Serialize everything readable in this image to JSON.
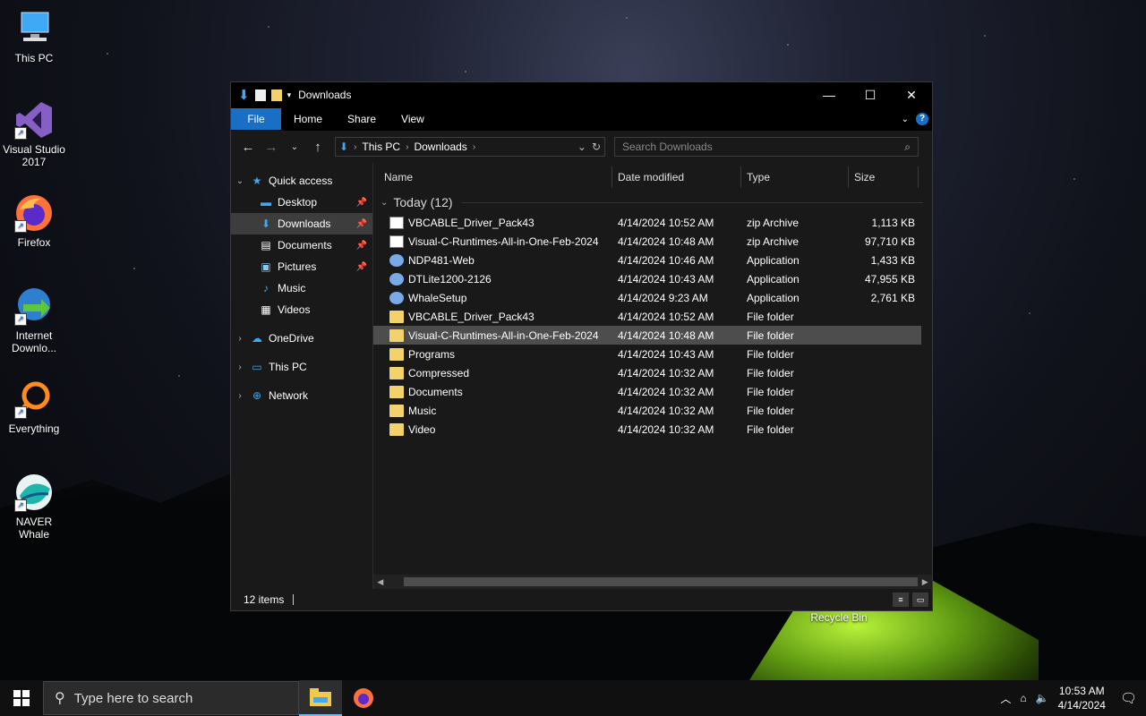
{
  "desktop": {
    "icons": [
      {
        "label": "This PC"
      },
      {
        "label": "Visual Studio 2017"
      },
      {
        "label": "Firefox"
      },
      {
        "label": "Internet Downlo..."
      },
      {
        "label": "Everything"
      },
      {
        "label": "NAVER Whale"
      }
    ],
    "recycle_bin": "Recycle Bin"
  },
  "window": {
    "title": "Downloads",
    "ribbon_tabs": [
      "File",
      "Home",
      "Share",
      "View"
    ],
    "help_glyph": "?",
    "address": {
      "segments": [
        "This PC",
        "Downloads"
      ]
    },
    "search_placeholder": "Search Downloads",
    "sidebar": {
      "quick_access": "Quick access",
      "pinned": [
        {
          "label": "Desktop",
          "pinned": true
        },
        {
          "label": "Downloads",
          "pinned": true,
          "selected": true
        },
        {
          "label": "Documents",
          "pinned": true
        },
        {
          "label": "Pictures",
          "pinned": true
        },
        {
          "label": "Music",
          "pinned": false
        },
        {
          "label": "Videos",
          "pinned": false
        }
      ],
      "onedrive": "OneDrive",
      "this_pc": "This PC",
      "network": "Network"
    },
    "columns": {
      "name": "Name",
      "date": "Date modified",
      "type": "Type",
      "size": "Size"
    },
    "group": "Today (12)",
    "files": [
      {
        "name": "VBCABLE_Driver_Pack43",
        "date": "4/14/2024 10:52 AM",
        "type": "zip Archive",
        "size": "1,113 KB",
        "icon": "zip"
      },
      {
        "name": "Visual-C-Runtimes-All-in-One-Feb-2024",
        "date": "4/14/2024 10:48 AM",
        "type": "zip Archive",
        "size": "97,710 KB",
        "icon": "zip"
      },
      {
        "name": "NDP481-Web",
        "date": "4/14/2024 10:46 AM",
        "type": "Application",
        "size": "1,433 KB",
        "icon": "app"
      },
      {
        "name": "DTLite1200-2126",
        "date": "4/14/2024 10:43 AM",
        "type": "Application",
        "size": "47,955 KB",
        "icon": "app"
      },
      {
        "name": "WhaleSetup",
        "date": "4/14/2024 9:23 AM",
        "type": "Application",
        "size": "2,761 KB",
        "icon": "app"
      },
      {
        "name": "VBCABLE_Driver_Pack43",
        "date": "4/14/2024 10:52 AM",
        "type": "File folder",
        "size": "",
        "icon": "folder"
      },
      {
        "name": "Visual-C-Runtimes-All-in-One-Feb-2024",
        "date": "4/14/2024 10:48 AM",
        "type": "File folder",
        "size": "",
        "icon": "folder",
        "selected": true
      },
      {
        "name": "Programs",
        "date": "4/14/2024 10:43 AM",
        "type": "File folder",
        "size": "",
        "icon": "folder"
      },
      {
        "name": "Compressed",
        "date": "4/14/2024 10:32 AM",
        "type": "File folder",
        "size": "",
        "icon": "folder"
      },
      {
        "name": "Documents",
        "date": "4/14/2024 10:32 AM",
        "type": "File folder",
        "size": "",
        "icon": "folder"
      },
      {
        "name": "Music",
        "date": "4/14/2024 10:32 AM",
        "type": "File folder",
        "size": "",
        "icon": "folder"
      },
      {
        "name": "Video",
        "date": "4/14/2024 10:32 AM",
        "type": "File folder",
        "size": "",
        "icon": "folder"
      }
    ],
    "status": "12 items"
  },
  "taskbar": {
    "search_placeholder": "Type here to search",
    "time": "10:53 AM",
    "date": "4/14/2024"
  },
  "colors": {
    "accent": "#1a6fc4",
    "selected_row": "#4d4d4d",
    "folder": "#f2d36b"
  }
}
